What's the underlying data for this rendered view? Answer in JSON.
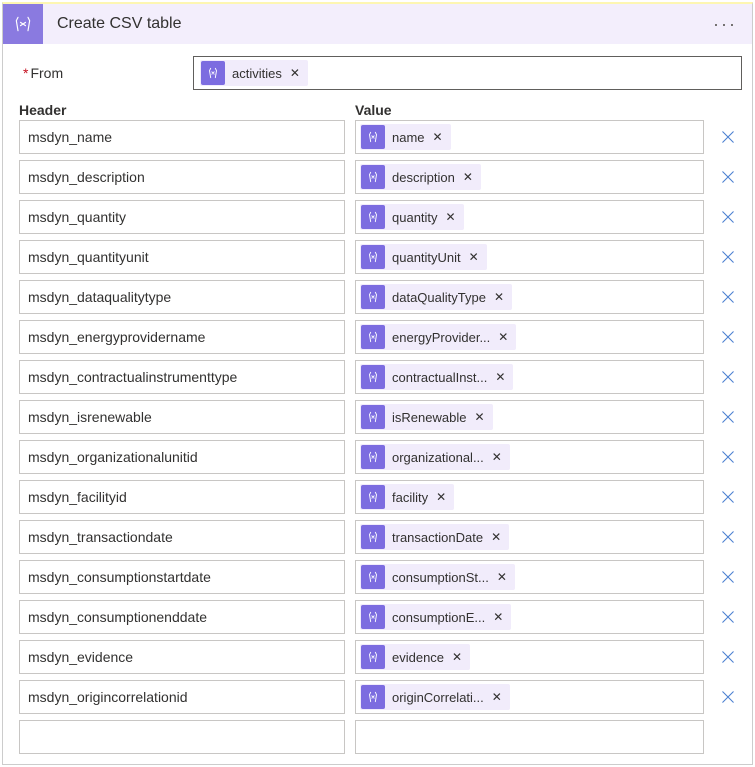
{
  "header": {
    "title": "Create CSV table"
  },
  "from": {
    "label": "From",
    "token": "activities"
  },
  "columns": {
    "header": "Header",
    "value": "Value"
  },
  "rows": [
    {
      "header": "msdyn_name",
      "value": "name"
    },
    {
      "header": "msdyn_description",
      "value": "description"
    },
    {
      "header": "msdyn_quantity",
      "value": "quantity"
    },
    {
      "header": "msdyn_quantityunit",
      "value": "quantityUnit"
    },
    {
      "header": "msdyn_dataqualitytype",
      "value": "dataQualityType"
    },
    {
      "header": "msdyn_energyprovidername",
      "value": "energyProvider..."
    },
    {
      "header": "msdyn_contractualinstrumenttype",
      "value": "contractualInst..."
    },
    {
      "header": "msdyn_isrenewable",
      "value": "isRenewable"
    },
    {
      "header": "msdyn_organizationalunitid",
      "value": "organizational..."
    },
    {
      "header": "msdyn_facilityid",
      "value": "facility"
    },
    {
      "header": "msdyn_transactiondate",
      "value": "transactionDate"
    },
    {
      "header": "msdyn_consumptionstartdate",
      "value": "consumptionSt..."
    },
    {
      "header": "msdyn_consumptionenddate",
      "value": "consumptionE..."
    },
    {
      "header": "msdyn_evidence",
      "value": "evidence"
    },
    {
      "header": "msdyn_origincorrelationid",
      "value": "originCorrelati..."
    }
  ]
}
